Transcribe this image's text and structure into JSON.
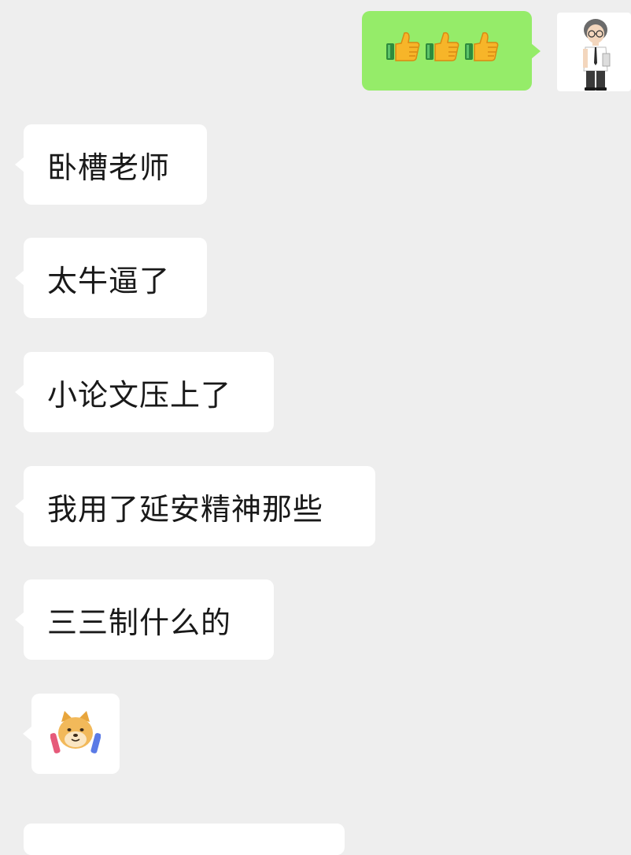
{
  "chat": {
    "outgoing": [
      {
        "type": "emoji",
        "emoji_name": "thumbs-up-icon",
        "count": 3
      }
    ],
    "incoming": [
      {
        "text": "卧槽老师"
      },
      {
        "text": "太牛逼了"
      },
      {
        "text": "小论文压上了"
      },
      {
        "text": "我用了延安精神那些"
      },
      {
        "text": "三三制什么的"
      },
      {
        "type": "sticker",
        "sticker_name": "doge-sticker"
      }
    ]
  },
  "colors": {
    "background": "#eeeeee",
    "outgoing_bubble": "#95ec69",
    "incoming_bubble": "#ffffff",
    "text": "#191919"
  }
}
